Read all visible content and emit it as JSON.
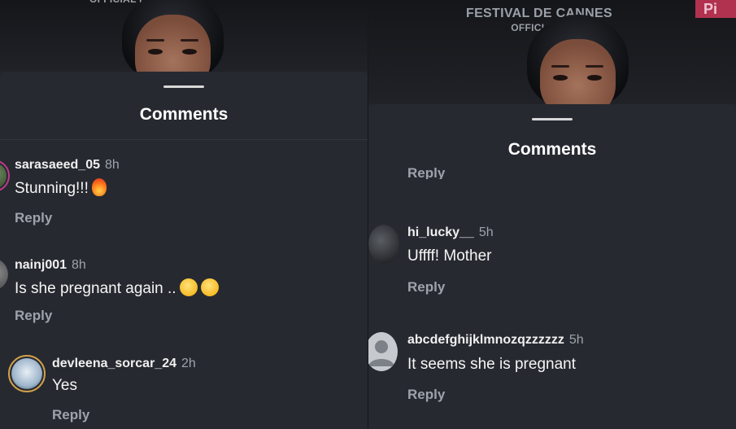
{
  "left": {
    "header": {
      "title": "Comments"
    },
    "comments": [
      {
        "username": "sarasaeed_05",
        "time": "8h",
        "text": "Stunning!!!",
        "emoji": "fire",
        "reply": "Reply"
      },
      {
        "username": "nainj001",
        "time": "8h",
        "text": "Is she pregnant again ..",
        "emoji": "thinking-face",
        "reply": "Reply"
      },
      {
        "username": "devleena_sorcar_24",
        "time": "2h",
        "text": "Yes",
        "reply": "Reply"
      }
    ]
  },
  "right": {
    "background": {
      "line1": "FESTIVAL DE CANNES",
      "line2": "OFFICIAL P"
    },
    "header": {
      "title": "Comments"
    },
    "partial_reply": "Reply",
    "comments": [
      {
        "username": "hi_lucky__",
        "time": "5h",
        "text": "Uffff! Mother",
        "reply": "Reply"
      },
      {
        "username": "abcdefghijklmnozqzzzzzz",
        "time": "5h",
        "text": "It seems she is pregnant",
        "reply": "Reply"
      }
    ]
  },
  "colors": {
    "background": "#262930",
    "ring": "#c23a8a",
    "muted": "#9ea3ab"
  }
}
